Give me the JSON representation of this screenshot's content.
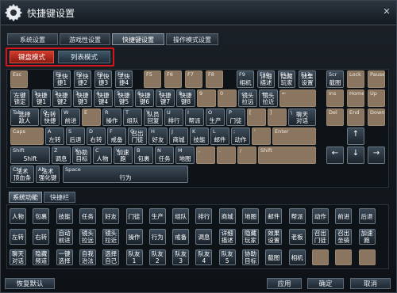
{
  "window": {
    "title": "快捷键设置",
    "close_symbol": "✕"
  },
  "tabs": [
    {
      "label": "系统设置",
      "active": false
    },
    {
      "label": "游戏性设置",
      "active": false
    },
    {
      "label": "快捷键设置",
      "active": true
    },
    {
      "label": "操作模式设置",
      "active": false
    }
  ],
  "modes": {
    "keyboard": "键盘模式",
    "list": "列表模式"
  },
  "keyboard": {
    "row1": [
      {
        "key": "Esc",
        "func": ""
      },
      {
        "key": "F1",
        "func": "主快\n捷1"
      },
      {
        "key": "F2",
        "func": "主快\n捷2"
      },
      {
        "key": "F3",
        "func": "主快\n捷3"
      },
      {
        "key": "F4",
        "func": "主快\n捷4"
      },
      {
        "key": "F5",
        "func": ""
      },
      {
        "key": "F6",
        "func": ""
      },
      {
        "key": "F7",
        "func": ""
      },
      {
        "key": "F8",
        "func": ""
      },
      {
        "key": "F9",
        "func": "相机"
      },
      {
        "key": "F10",
        "func": "详细\n描述"
      },
      {
        "key": "F11",
        "func": "隐藏\n玩家"
      },
      {
        "key": "F12",
        "func": "效果\n设置"
      },
      {
        "key": "Scr",
        "func": "截图"
      },
      {
        "key": "Lock",
        "func": ""
      },
      {
        "key": "Pause",
        "func": ""
      }
    ],
    "row2": [
      {
        "key": "~",
        "func": "左键\n锁定"
      },
      {
        "key": "1",
        "func": "快捷\n键1"
      },
      {
        "key": "2",
        "func": "快捷\n键2"
      },
      {
        "key": "3",
        "func": "快捷\n键3"
      },
      {
        "key": "4",
        "func": "快捷\n键4"
      },
      {
        "key": "5",
        "func": "快捷\n键5"
      },
      {
        "key": "6",
        "func": "快捷\n键6"
      },
      {
        "key": "7",
        "func": "快捷\n键7"
      },
      {
        "key": "8",
        "func": "快捷\n键8"
      },
      {
        "key": "9",
        "func": ""
      },
      {
        "key": "0",
        "func": ""
      },
      {
        "key": "-",
        "func": "镜头\n拉远"
      },
      {
        "key": "=",
        "func": "镜头\n拉近"
      },
      {
        "key": "←",
        "func": ""
      },
      {
        "key": "Ins",
        "func": ""
      },
      {
        "key": "Home",
        "func": ""
      },
      {
        "key": "Up",
        "func": ""
      }
    ],
    "row3": [
      {
        "key": "Tab",
        "func": "选择\n敌人"
      },
      {
        "key": "Q",
        "func": "右转\n快捷"
      },
      {
        "key": "W",
        "func": "前进"
      },
      {
        "key": "E",
        "func": ""
      },
      {
        "key": "R",
        "func": "操作"
      },
      {
        "key": "T",
        "func": "组队"
      },
      {
        "key": "Y",
        "func": "队员\n回复"
      },
      {
        "key": "U",
        "func": "排行"
      },
      {
        "key": "I",
        "func": "帮派"
      },
      {
        "key": "O",
        "func": "生产"
      },
      {
        "key": "P",
        "func": "门徒"
      },
      {
        "key": "[",
        "func": ""
      },
      {
        "key": "]",
        "func": ""
      },
      {
        "key": "\\",
        "func": "聊天\n对话"
      },
      {
        "key": "Del",
        "func": ""
      },
      {
        "key": "End",
        "func": ""
      },
      {
        "key": "Down",
        "func": ""
      }
    ],
    "row4": [
      {
        "key": "Caps",
        "func": ""
      },
      {
        "key": "A",
        "func": "左转"
      },
      {
        "key": "S",
        "func": "后退"
      },
      {
        "key": "D",
        "func": "右转"
      },
      {
        "key": "F",
        "func": "戒备"
      },
      {
        "key": "G",
        "func": "召出\n门徒"
      },
      {
        "key": "H",
        "func": "好友"
      },
      {
        "key": "J",
        "func": "商城"
      },
      {
        "key": "K",
        "func": "技能"
      },
      {
        "key": "L",
        "func": "邮件"
      },
      {
        "key": ";",
        "func": "动作"
      },
      {
        "key": "'",
        "func": ""
      },
      {
        "key": "Enter",
        "func": ""
      }
    ],
    "row5": [
      {
        "key": "Shift",
        "func": "Shift"
      },
      {
        "key": "Z",
        "func": "调息"
      },
      {
        "key": "X",
        "func": "协助\n目标"
      },
      {
        "key": "C",
        "func": "人物"
      },
      {
        "key": "V",
        "func": "加速跑"
      },
      {
        "key": "B",
        "func": "包裹"
      },
      {
        "key": "N",
        "func": "任务"
      },
      {
        "key": "M",
        "func": "地图"
      },
      {
        "key": ",",
        "func": ""
      },
      {
        "key": ".",
        "func": ""
      },
      {
        "key": "/",
        "func": ""
      },
      {
        "key": "Shift",
        "func": ""
      }
    ],
    "row6": [
      {
        "key": "Ctrl",
        "func": "法术\n顶血条"
      },
      {
        "key": "Alt",
        "func": "法术\n强化键"
      },
      {
        "key": "Space",
        "func": "行为"
      }
    ],
    "arrows": {
      "left": "←",
      "up": "↑",
      "down": "↓",
      "right": "→"
    }
  },
  "bottom_tabs": [
    {
      "label": "系统功能",
      "active": true
    },
    {
      "label": "快捷栏",
      "active": false
    }
  ],
  "functions": {
    "row1": [
      "人物",
      "包裹",
      "技能",
      "任务",
      "好友",
      "门徒",
      "生产",
      "组队",
      "排行",
      "商城",
      "地图",
      "邮件",
      "帮派",
      "动作",
      "前进",
      "后退"
    ],
    "row2": [
      "左转",
      "右转",
      "自动\n前进",
      "镜头\n拉远",
      "镜头\n拉近",
      "操作",
      "行为",
      "戒备",
      "调息",
      "详细\n描述",
      "隐藏\n玩家",
      "效果\n设置",
      "老板",
      "召出\n门徒",
      "召出\n坐骑",
      "加速跑"
    ],
    "row3": [
      "聊天\n对话",
      "隐藏\n频道",
      "一键\n选择",
      "自我\n治法",
      "选择\n自己",
      "队友1",
      "队友2",
      "队友3",
      "队友4",
      "队友5",
      "协助\n目标",
      "截图",
      "相机",
      "",
      "",
      ""
    ]
  },
  "footer": {
    "reset": "恢复默认",
    "apply": "应用",
    "ok": "确定",
    "cancel": "取消"
  }
}
